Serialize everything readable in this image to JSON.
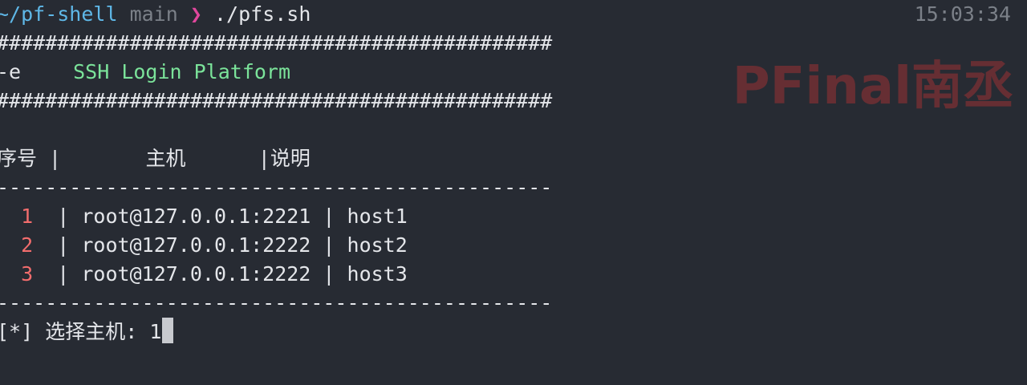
{
  "prompt": {
    "path": "~/pf-shell",
    "branch": "main",
    "arrow": "❯",
    "command": "./pfs.sh"
  },
  "clock": "15:03:34",
  "watermark": "PFinal南丞",
  "banner": {
    "hash_line": "##############################################",
    "flag": "-e",
    "title": "SSH Login Platform"
  },
  "table": {
    "header": "序号 |       主机      |说明",
    "separator": "----------------------------------------------",
    "rows": [
      {
        "num": "1",
        "host": "| root@127.0.0.1:2221 |",
        "desc": "host1"
      },
      {
        "num": "2",
        "host": "| root@127.0.0.1:2222 |",
        "desc": "host2"
      },
      {
        "num": "3",
        "host": "| root@127.0.0.1:2222 |",
        "desc": "host3"
      }
    ]
  },
  "input": {
    "prompt": "[*] 选择主机: ",
    "value": "1"
  },
  "colors": {
    "background": "#272b33",
    "path": "#5fb8e8",
    "arrow": "#e0479d",
    "green": "#7be39a",
    "number": "#f36d6d",
    "watermark": "#6a2f33"
  }
}
